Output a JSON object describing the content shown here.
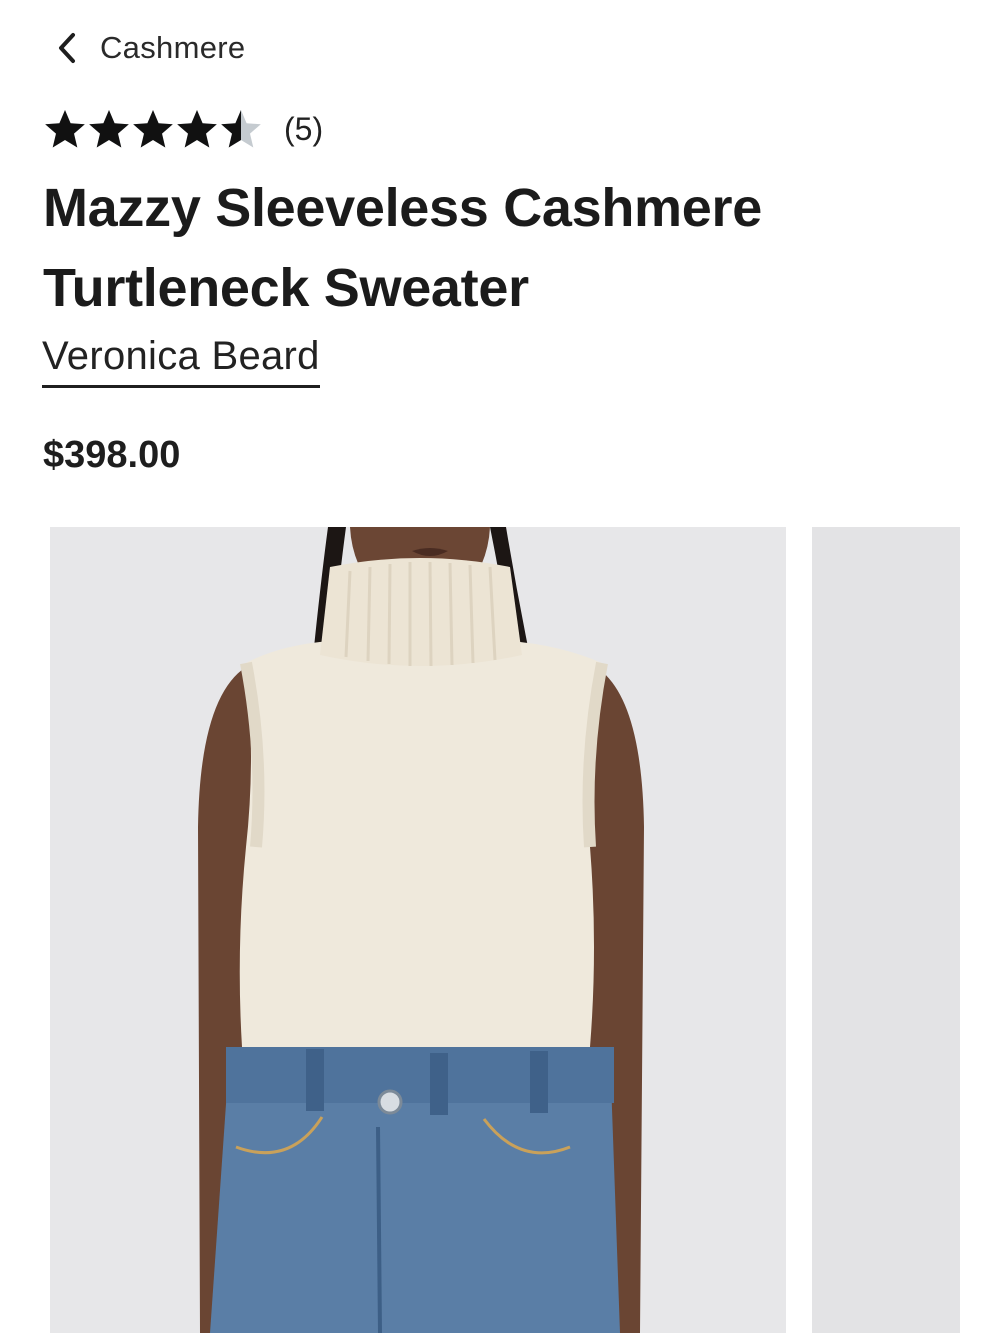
{
  "breadcrumb": {
    "back_icon": "chevron-left-icon",
    "label": "Cashmere"
  },
  "rating": {
    "value": 4.5,
    "max": 5,
    "review_count": "(5)",
    "star_filled_color": "#111111",
    "star_empty_color": "#c5cbd0"
  },
  "product": {
    "title_line1": "Mazzy Sleeveless Cashmere",
    "title_line2": "Turtleneck Sweater",
    "brand": "Veronica Beard",
    "price": "$398.00"
  },
  "gallery": {
    "images": [
      {
        "name": "model-front-photo"
      },
      {
        "name": "model-side-photo"
      }
    ]
  }
}
